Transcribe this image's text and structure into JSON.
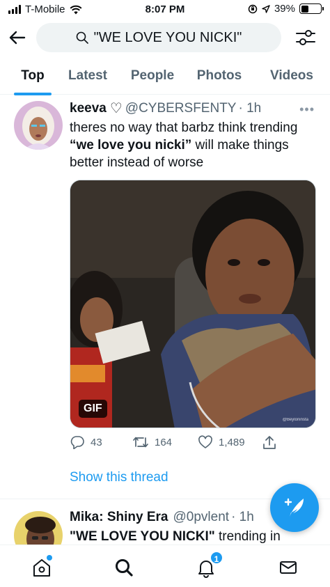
{
  "status_bar": {
    "carrier": "T-Mobile",
    "time": "8:07 PM",
    "battery": "39%",
    "battery_level": 0.39
  },
  "header": {
    "search_query": "\"WE LOVE YOU NICKI\""
  },
  "tabs": [
    {
      "label": "Top",
      "active": true
    },
    {
      "label": "Latest",
      "active": false
    },
    {
      "label": "People",
      "active": false
    },
    {
      "label": "Photos",
      "active": false
    },
    {
      "label": "Videos",
      "active": false
    }
  ],
  "tweet": {
    "name": "keeva",
    "name_suffix": "♡",
    "handle": "@CYBERSFENTY",
    "time": "· 1h",
    "text_before": "theres no way that barbz think trending ",
    "text_bold": "“we love you nicki”",
    "text_after": " will make things better instead of worse",
    "media_badge": "GIF",
    "media_watermark": "@Beyloninsta",
    "replies": "43",
    "retweets": "164",
    "likes": "1,489",
    "show_thread": "Show this thread"
  },
  "tweet2": {
    "name": "Mika: Shiny Era",
    "handle": "@0pvlent",
    "time": "· 1h",
    "text_bold": "\"WE LOVE YOU NICKI\"",
    "text_after": " trending in"
  },
  "notifications_count": "1",
  "colors": {
    "accent": "#1d9bf0",
    "text": "#0f1419",
    "secondary": "#536471"
  }
}
